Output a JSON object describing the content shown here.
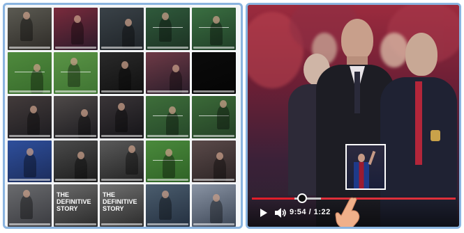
{
  "left_grid": {
    "thumbnails": [
      {
        "name": "man-in-jacket-interview",
        "colors": [
          "#5b5a52",
          "#2f2c28"
        ]
      },
      {
        "name": "player-celebrating",
        "colors": [
          "#7a2b3c",
          "#2b1a2a"
        ]
      },
      {
        "name": "stadium-dark",
        "colors": [
          "#3a4248",
          "#1f2428"
        ]
      },
      {
        "name": "match-action",
        "colors": [
          "#2f5a3b",
          "#1d3324"
        ]
      },
      {
        "name": "players-running",
        "colors": [
          "#3a6f41",
          "#213f28"
        ]
      },
      {
        "name": "pitch-top-view",
        "colors": [
          "#4f8a3d",
          "#386b2c"
        ]
      },
      {
        "name": "pitch-goal",
        "colors": [
          "#5a9446",
          "#3f7432"
        ]
      },
      {
        "name": "dark-crowd",
        "colors": [
          "#2a2a2a",
          "#101010"
        ]
      },
      {
        "name": "player-portrait",
        "colors": [
          "#6e3a46",
          "#2a1d2a"
        ]
      },
      {
        "name": "black-frame",
        "colors": [
          "#0b0b0b",
          "#050505"
        ]
      },
      {
        "name": "coaches-bench",
        "colors": [
          "#433b3b",
          "#1d1c20"
        ]
      },
      {
        "name": "coach-black-suit",
        "colors": [
          "#4f4a49",
          "#1c1b1f"
        ]
      },
      {
        "name": "coach-standing",
        "colors": [
          "#3a3538",
          "#151418"
        ]
      },
      {
        "name": "red-players-pitch",
        "colors": [
          "#3e6e3a",
          "#26482a"
        ]
      },
      {
        "name": "red-players-field",
        "colors": [
          "#3b6a38",
          "#244026"
        ]
      },
      {
        "name": "player-blue-ball",
        "colors": [
          "#2e4f9c",
          "#1c2d5c"
        ]
      },
      {
        "name": "bald-man-interview",
        "colors": [
          "#4b4b4b",
          "#1b1b1b"
        ]
      },
      {
        "name": "bald-man-bw",
        "colors": [
          "#5a5a5a",
          "#222"
        ]
      },
      {
        "name": "pitch-blue-players",
        "colors": [
          "#4a8a3c",
          "#2f6226"
        ]
      },
      {
        "name": "crowd-coach",
        "colors": [
          "#5b4a4a",
          "#2b2424"
        ]
      },
      {
        "name": "man-speaking",
        "colors": [
          "#6a6b6e",
          "#3a3b40"
        ]
      },
      {
        "name": "definitive-story-1",
        "colors": [
          "#6b6b6b",
          "#2a2a2a"
        ]
      },
      {
        "name": "definitive-story-2",
        "colors": [
          "#707070",
          "#2c2c2c"
        ]
      },
      {
        "name": "player-jersey",
        "colors": [
          "#4b5d6e",
          "#243040"
        ]
      },
      {
        "name": "stadium-lights",
        "colors": [
          "#8a94a4",
          "#3c4656"
        ]
      }
    ],
    "story_text": "THE\nDEFINITIVE\nSTORY"
  },
  "player": {
    "time_display": "9:54 / 1:22",
    "progress_played": 0.21,
    "progress_buffered_start": 0.34,
    "progress_buffered_end": 1.0,
    "accent": "#e01e2a"
  },
  "icons": {
    "play": "play-icon",
    "volume": "volume-icon",
    "hand": "hand-pointer-icon"
  }
}
